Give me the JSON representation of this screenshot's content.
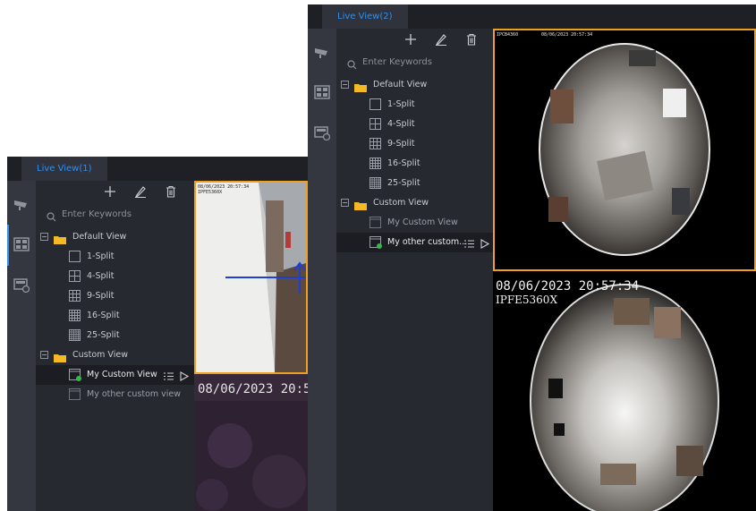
{
  "window1": {
    "tab": "Live View(1)",
    "search_placeholder": "Enter Keywords",
    "tree": {
      "default_view": "Default View",
      "splits": [
        "1-Split",
        "4-Split",
        "9-Split",
        "16-Split",
        "25-Split"
      ],
      "custom_view": "Custom View",
      "custom_items": [
        "My Custom View",
        "My other custom view"
      ]
    },
    "cameras": [
      {
        "timestamp": "08/06/2023 20:57:34",
        "name": "IPFE5360X"
      },
      {
        "timestamp": "08/06/2023 20:5"
      }
    ]
  },
  "window2": {
    "tab": "Live View(2)",
    "search_placeholder": "Enter Keywords",
    "tree": {
      "default_view": "Default View",
      "splits": [
        "1-Split",
        "4-Split",
        "9-Split",
        "16-Split",
        "25-Split"
      ],
      "custom_view": "Custom View",
      "custom_items": [
        "My Custom View",
        "My other custom..."
      ]
    },
    "cameras": [
      {
        "name": "IPCB4360",
        "timestamp": "08/06/2023 20:57:34"
      },
      {
        "timestamp": "08/06/2023 20:57:34",
        "name": "IPFE5360X"
      }
    ]
  },
  "colors": {
    "accent": "#2f8ff0",
    "selected_border": "#f0a020",
    "folder": "#f4b925",
    "online_badge": "#39b54a",
    "motion_arrow": "#1f3fd0"
  },
  "icons": [
    "camera-icon",
    "grid-icon",
    "playback-icon",
    "add-icon",
    "edit-icon",
    "trash-icon",
    "search-icon",
    "folder-icon",
    "list-icon",
    "play-icon"
  ]
}
